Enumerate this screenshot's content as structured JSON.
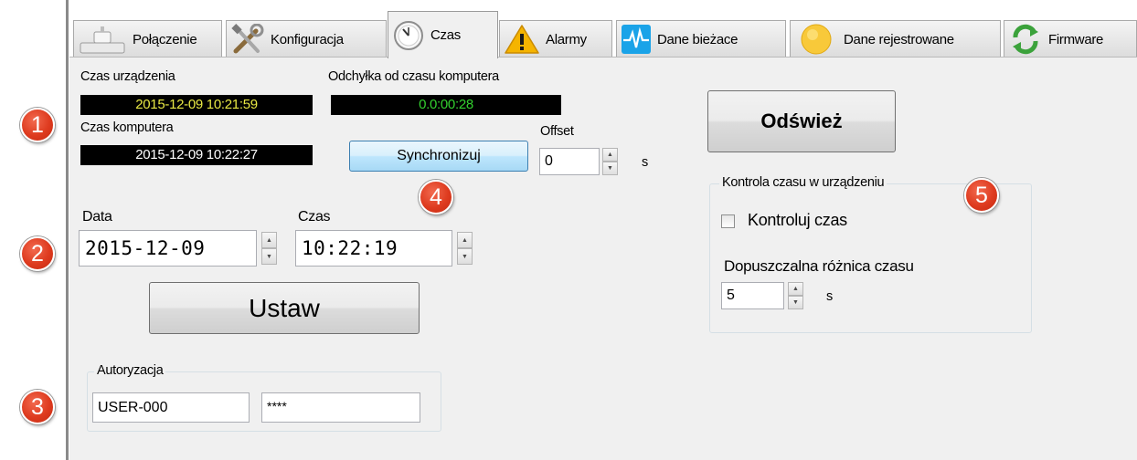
{
  "tabs": [
    {
      "label": "Połączenie",
      "icon": "connection-icon"
    },
    {
      "label": "Konfiguracja",
      "icon": "tools-icon"
    },
    {
      "label": "Czas",
      "icon": "clock-icon",
      "active": true
    },
    {
      "label": "Alarmy",
      "icon": "warning-icon"
    },
    {
      "label": "Dane bieżace",
      "icon": "pulse-icon"
    },
    {
      "label": "Dane rejestrowane",
      "icon": "yellow-circle-icon"
    },
    {
      "label": "Firmware",
      "icon": "refresh-icon"
    }
  ],
  "device_time": {
    "label": "Czas urządzenia",
    "value": "2015-12-09  10:21:59"
  },
  "offset_from_pc": {
    "label": "Odchyłka od czasu komputera",
    "value": "0.0:00:28"
  },
  "computer_time": {
    "label": "Czas komputera",
    "value": "2015-12-09  10:22:27"
  },
  "sync": {
    "button_label": "Synchronizuj",
    "offset_label": "Offset",
    "offset_value": "0",
    "unit": "s"
  },
  "refresh_button": {
    "label": "Odśwież"
  },
  "set_datetime": {
    "date_label": "Data",
    "date_value": "2015-12-09",
    "time_label": "Czas",
    "time_value": "10:22:19",
    "set_button": "Ustaw"
  },
  "authorization": {
    "title": "Autoryzacja",
    "user": "USER-000",
    "password": "****"
  },
  "time_control": {
    "title": "Kontrola czasu w urządzeniu",
    "checkbox_label": "Kontroluj czas",
    "checked": false,
    "tolerance_label": "Dopuszczalna różnica czasu",
    "tolerance_value": "5",
    "unit": "s"
  },
  "markers": [
    "1",
    "2",
    "3",
    "4",
    "5"
  ],
  "colors": {
    "marker_red": "#de3b1f",
    "clock_yellow": "#e8e844",
    "clock_green": "#33d02f",
    "panel_bg": "#f0f0f0"
  }
}
